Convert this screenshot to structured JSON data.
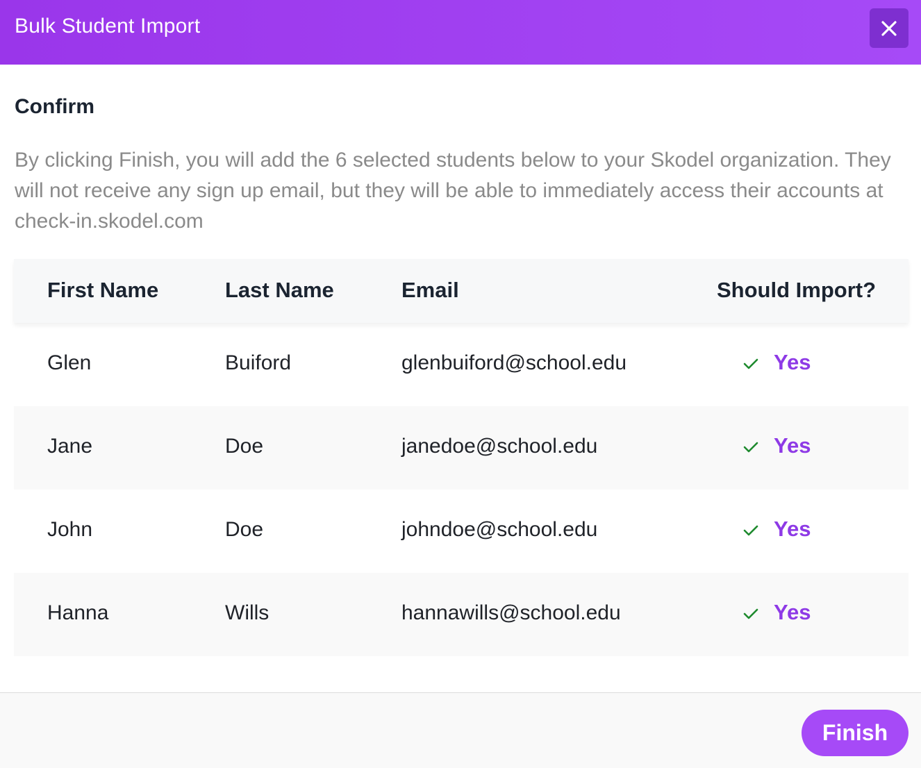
{
  "header": {
    "title": "Bulk Student Import",
    "close_icon": "close-icon"
  },
  "confirm": {
    "title": "Confirm",
    "description": "By clicking Finish, you will add the 6 selected students below to your Skodel organization. They will not receive any sign up email, but they will be able to immediately access their accounts at check-in.skodel.com"
  },
  "table": {
    "columns": [
      "First Name",
      "Last Name",
      "Email",
      "Should Import?"
    ],
    "rows": [
      {
        "first": "Glen",
        "last": "Buiford",
        "email": "glenbuiford@school.edu",
        "import": "Yes"
      },
      {
        "first": "Jane",
        "last": "Doe",
        "email": "janedoe@school.edu",
        "import": "Yes"
      },
      {
        "first": "John",
        "last": "Doe",
        "email": "johndoe@school.edu",
        "import": "Yes"
      },
      {
        "first": "Hanna",
        "last": "Wills",
        "email": "hannawills@school.edu",
        "import": "Yes"
      }
    ]
  },
  "footer": {
    "finish_label": "Finish"
  },
  "colors": {
    "brand_purple": "#a64af7",
    "check_green": "#1e8a2e",
    "yes_purple": "#8e3ae6"
  }
}
